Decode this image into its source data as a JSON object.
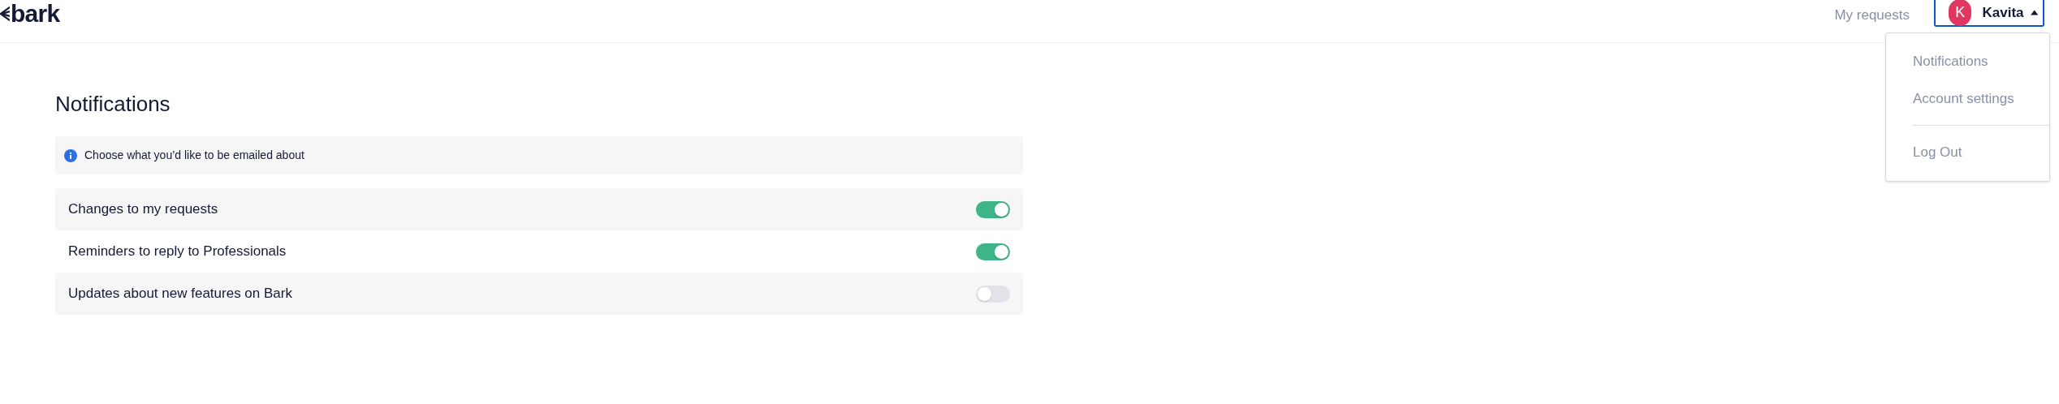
{
  "header": {
    "logo": "bark",
    "nav_link": "My requests",
    "user": {
      "initial": "K",
      "name": "Kavita",
      "menu_open": true
    }
  },
  "user_menu": {
    "items": [
      {
        "label": "Notifications",
        "divider_before": false
      },
      {
        "label": "Account settings",
        "divider_before": false
      },
      {
        "label": "Log Out",
        "divider_before": true
      }
    ]
  },
  "page": {
    "title": "Notifications",
    "info": "Choose what you’d like to be emailed about",
    "settings": [
      {
        "label": "Changes to my requests",
        "on": true
      },
      {
        "label": "Reminders to reply to Professionals",
        "on": true
      },
      {
        "label": "Updates about new features on Bark",
        "on": false
      }
    ]
  }
}
